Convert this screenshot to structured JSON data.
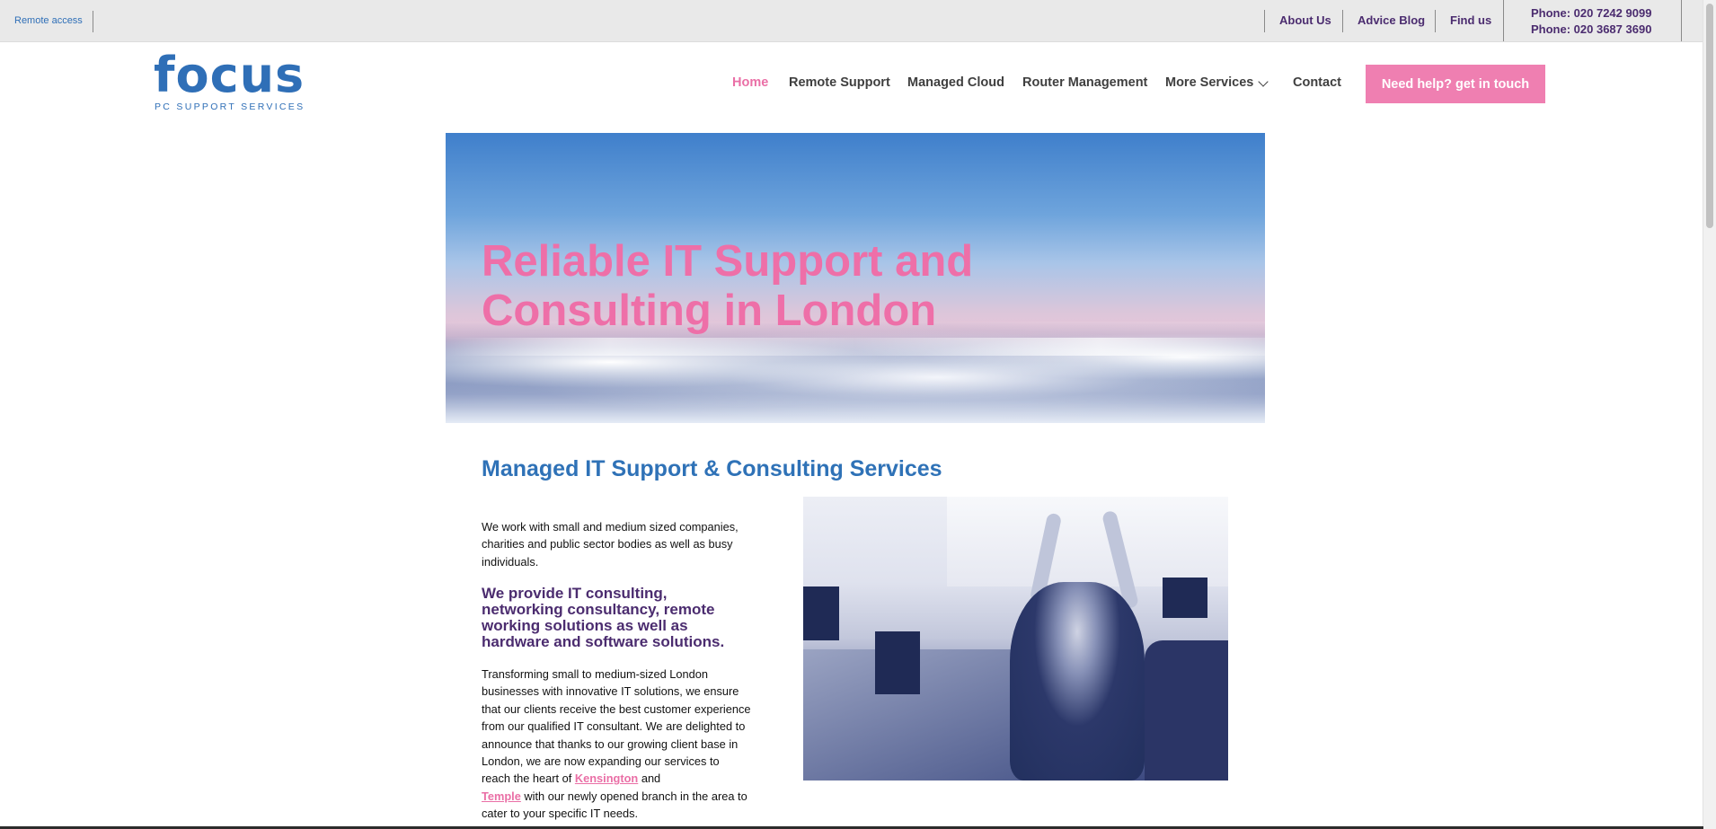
{
  "topbar": {
    "remote_access": "Remote access",
    "links": [
      "About Us",
      "Advice Blog",
      "Find us"
    ],
    "phones": [
      "Phone: 020 7242 9099",
      "Phone: 020 3687 3690"
    ]
  },
  "logo": {
    "word": "focus",
    "tagline": "PC SUPPORT SERVICES"
  },
  "nav": {
    "items": [
      "Home",
      "Remote Support",
      "Managed Cloud",
      "Router Management",
      "More Services",
      "Contact"
    ],
    "active": "Home",
    "cta": "Need help? get in touch"
  },
  "hero": {
    "line1": "Reliable IT Support and",
    "line2": "Consulting in London"
  },
  "content": {
    "section_title": "Managed IT Support & Consulting Services",
    "intro": "We work with small and medium sized companies, charities and public sector bodies as well as busy individuals.",
    "lead": "We provide IT consulting, networking consultancy, remote working solutions as well as hardware and software solutions.",
    "body_start": "Transforming small to medium-sized London businesses with innovative IT solutions, we ensure that our clients receive the best customer experience from our qualified IT consultant. We are delighted to announce that thanks to our growing client base in London, we are now expanding our services to reach the heart of ",
    "link_kensington": "Kensington",
    "body_and": " and",
    "link_temple": "Temple",
    "body_end": " with our newly opened branch in the area to cater to your specific IT needs."
  },
  "colors": {
    "brand_blue": "#2f6fb7",
    "pink": "#ef7fb1",
    "purple": "#4b2c6f"
  }
}
